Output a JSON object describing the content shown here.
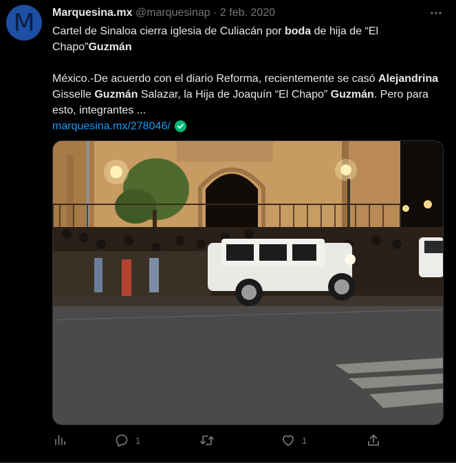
{
  "author": {
    "avatar_letter": "M",
    "name": "Marquesina.mx",
    "handle": "@marquesinap",
    "separator": "·",
    "date": "2 feb. 2020"
  },
  "more_icon": "more-horizontal-icon",
  "tweet": {
    "title_part1": "Cartel de Sinaloa cierra iglesia de Culiacán por ",
    "title_bold1": "boda",
    "title_part2": " de hija de “El Chapo”",
    "title_bold2": "Guzmán",
    "body_part1": "México.-De acuerdo con el diario Reforma, recientemente se casó ",
    "body_bold1": "Alejandrina",
    "body_part2": " Gisselle ",
    "body_bold2": "Guzmán",
    "body_part3": " Salazar, la Hija de Joaquín “El Chapo” ",
    "body_bold3": "Guzmán",
    "body_part4": ". Pero para esto, integrantes  ...",
    "link": "marquesina.mx/278046/"
  },
  "actions": {
    "analytics_icon": "bar-chart-icon",
    "reply_icon": "reply-icon",
    "reply_count": "1",
    "retweet_icon": "retweet-icon",
    "like_icon": "heart-icon",
    "like_count": "1",
    "share_icon": "share-icon"
  },
  "colors": {
    "background": "#000000",
    "text": "#e7e9ea",
    "muted": "#71767b",
    "link": "#1d9bf0",
    "verified": "#00ba7c",
    "avatar": "#1d4fa3"
  }
}
